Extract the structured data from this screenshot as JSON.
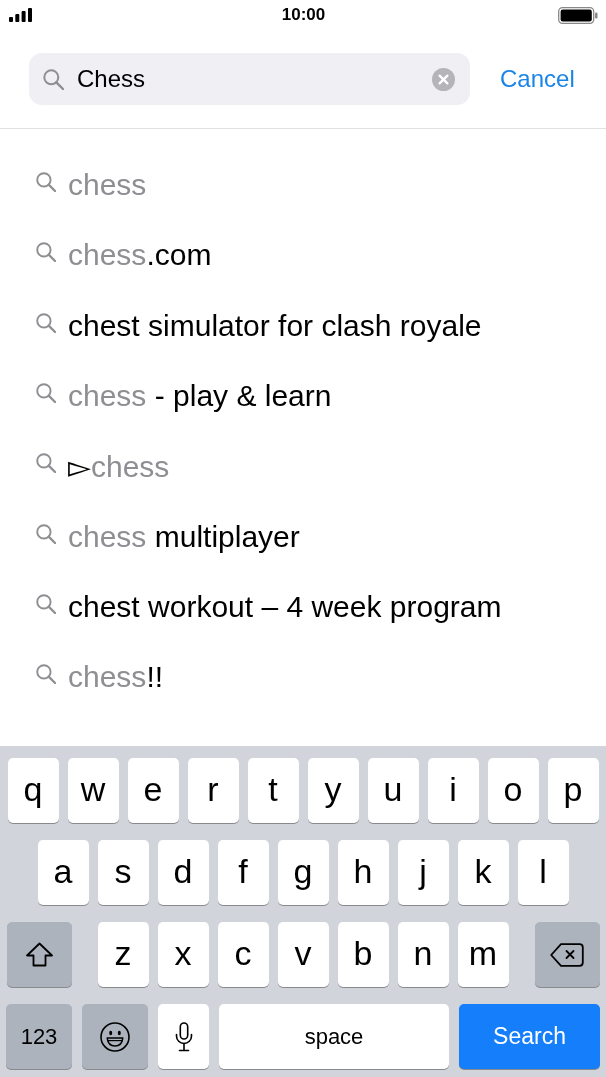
{
  "status_bar": {
    "time": "10:00"
  },
  "search": {
    "value": "Chess",
    "cancel": "Cancel"
  },
  "suggestions": [
    {
      "parts": [
        {
          "text": "chess",
          "matched": true
        }
      ]
    },
    {
      "parts": [
        {
          "text": "chess",
          "matched": true
        },
        {
          "text": ".com",
          "matched": false
        }
      ]
    },
    {
      "parts": [
        {
          "text": "chest simulator for clash royale",
          "matched": false
        }
      ]
    },
    {
      "parts": [
        {
          "text": "chess",
          "matched": true
        },
        {
          "text": " - play & learn",
          "matched": false
        }
      ]
    },
    {
      "parts": [
        {
          "text": "▻",
          "matched": false
        },
        {
          "text": "chess",
          "matched": true
        }
      ]
    },
    {
      "parts": [
        {
          "text": "chess",
          "matched": true
        },
        {
          "text": " multiplayer",
          "matched": false
        }
      ]
    },
    {
      "parts": [
        {
          "text": "chest workout – 4 week program",
          "matched": false
        }
      ]
    },
    {
      "parts": [
        {
          "text": "chess",
          "matched": true
        },
        {
          "text": "!!",
          "matched": false
        }
      ]
    }
  ],
  "keyboard": {
    "rows": [
      {
        "keys": [
          {
            "kind": "letter",
            "label": "q"
          },
          {
            "kind": "letter",
            "label": "w"
          },
          {
            "kind": "letter",
            "label": "e"
          },
          {
            "kind": "letter",
            "label": "r"
          },
          {
            "kind": "letter",
            "label": "t"
          },
          {
            "kind": "letter",
            "label": "y"
          },
          {
            "kind": "letter",
            "label": "u"
          },
          {
            "kind": "letter",
            "label": "i"
          },
          {
            "kind": "letter",
            "label": "o"
          },
          {
            "kind": "letter",
            "label": "p"
          }
        ]
      },
      {
        "keys": [
          {
            "kind": "letter",
            "label": "a"
          },
          {
            "kind": "letter",
            "label": "s"
          },
          {
            "kind": "letter",
            "label": "d"
          },
          {
            "kind": "letter",
            "label": "f"
          },
          {
            "kind": "letter",
            "label": "g"
          },
          {
            "kind": "letter",
            "label": "h"
          },
          {
            "kind": "letter",
            "label": "j"
          },
          {
            "kind": "letter",
            "label": "k"
          },
          {
            "kind": "letter",
            "label": "l"
          }
        ]
      },
      {
        "keys": [
          {
            "kind": "shift"
          },
          {
            "kind": "letter",
            "label": "z"
          },
          {
            "kind": "letter",
            "label": "x"
          },
          {
            "kind": "letter",
            "label": "c"
          },
          {
            "kind": "letter",
            "label": "v"
          },
          {
            "kind": "letter",
            "label": "b"
          },
          {
            "kind": "letter",
            "label": "n"
          },
          {
            "kind": "letter",
            "label": "m"
          },
          {
            "kind": "delete"
          }
        ]
      },
      {
        "keys": [
          {
            "kind": "mode",
            "label": "123"
          },
          {
            "kind": "emoji"
          },
          {
            "kind": "dictation"
          },
          {
            "kind": "space",
            "label": "space"
          },
          {
            "kind": "return",
            "label": "Search"
          }
        ]
      }
    ]
  }
}
